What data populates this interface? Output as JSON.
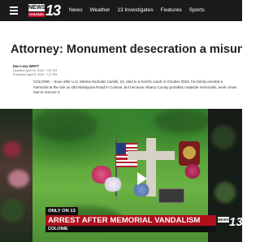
{
  "header": {
    "logo": {
      "word": "NEWS",
      "channel": "CHANNEL",
      "number": "13"
    },
    "nav": [
      "News",
      "Weather",
      "13 Investigates",
      "Features",
      "Sports"
    ]
  },
  "article": {
    "headline": "Attorney: Monument desecration a misunderstanding",
    "author": "Dan Levy WNYT",
    "updated": "Updated: April 10, 2025 - 7:01 PM",
    "published": "Published: April 8, 2025 - 7:27 PM",
    "body": "COLONIE – Soon after U.S. Marine Nicholas Camilli, 24, died in a horrific crash in October 2023, his family erected a memorial at the site on Old Niskayuna Road in Colonie, but because Albany County prohibits roadside memorials, work crews had to remove it."
  },
  "video": {
    "tag": "ONLY ON 13",
    "banner": "ARREST AFTER MEMORIAL VANDALISM",
    "location": "COLONIE",
    "bug": {
      "word": "NEWS",
      "number": "13"
    }
  },
  "colors": {
    "topbar": "#1a1a1a",
    "brand_red": "#c8102e",
    "banner_red": "#b0101c"
  }
}
